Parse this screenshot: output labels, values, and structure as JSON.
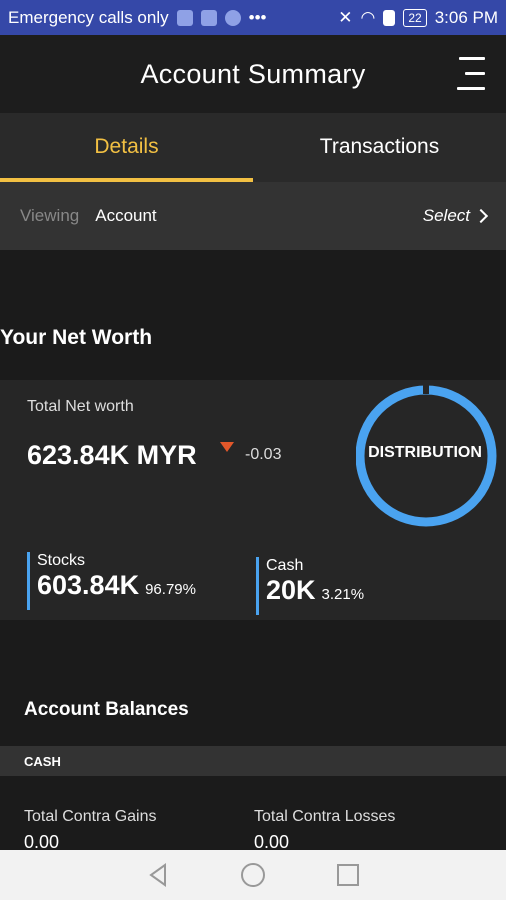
{
  "status_bar": {
    "carrier_text": "Emergency calls only",
    "battery": "22",
    "time": "3:06 PM"
  },
  "header": {
    "title": "Account Summary"
  },
  "tabs": [
    {
      "label": "Details",
      "active": true
    },
    {
      "label": "Transactions",
      "active": false
    }
  ],
  "viewing": {
    "label": "Viewing",
    "value": "Account",
    "select_label": "Select"
  },
  "net_worth": {
    "section_title": "Your Net Worth",
    "total_label": "Total Net worth",
    "total_value": "623.84K MYR",
    "change": "-0.03",
    "distribution_label": "DISTRIBUTION",
    "assets": [
      {
        "name": "Stocks",
        "value": "603.84K",
        "percent": "96.79%"
      },
      {
        "name": "Cash",
        "value": "20K",
        "percent": "3.21%"
      }
    ]
  },
  "balances": {
    "section_title": "Account Balances",
    "cash_header": "CASH",
    "items": [
      {
        "label": "Total Contra Gains",
        "value": "0.00"
      },
      {
        "label": "Total Contra Losses",
        "value": "0.00"
      }
    ]
  },
  "colors": {
    "accent": "#f2c043",
    "ring": "#4aa3f0",
    "status_bar": "#3548a8",
    "down": "#e2572a"
  }
}
